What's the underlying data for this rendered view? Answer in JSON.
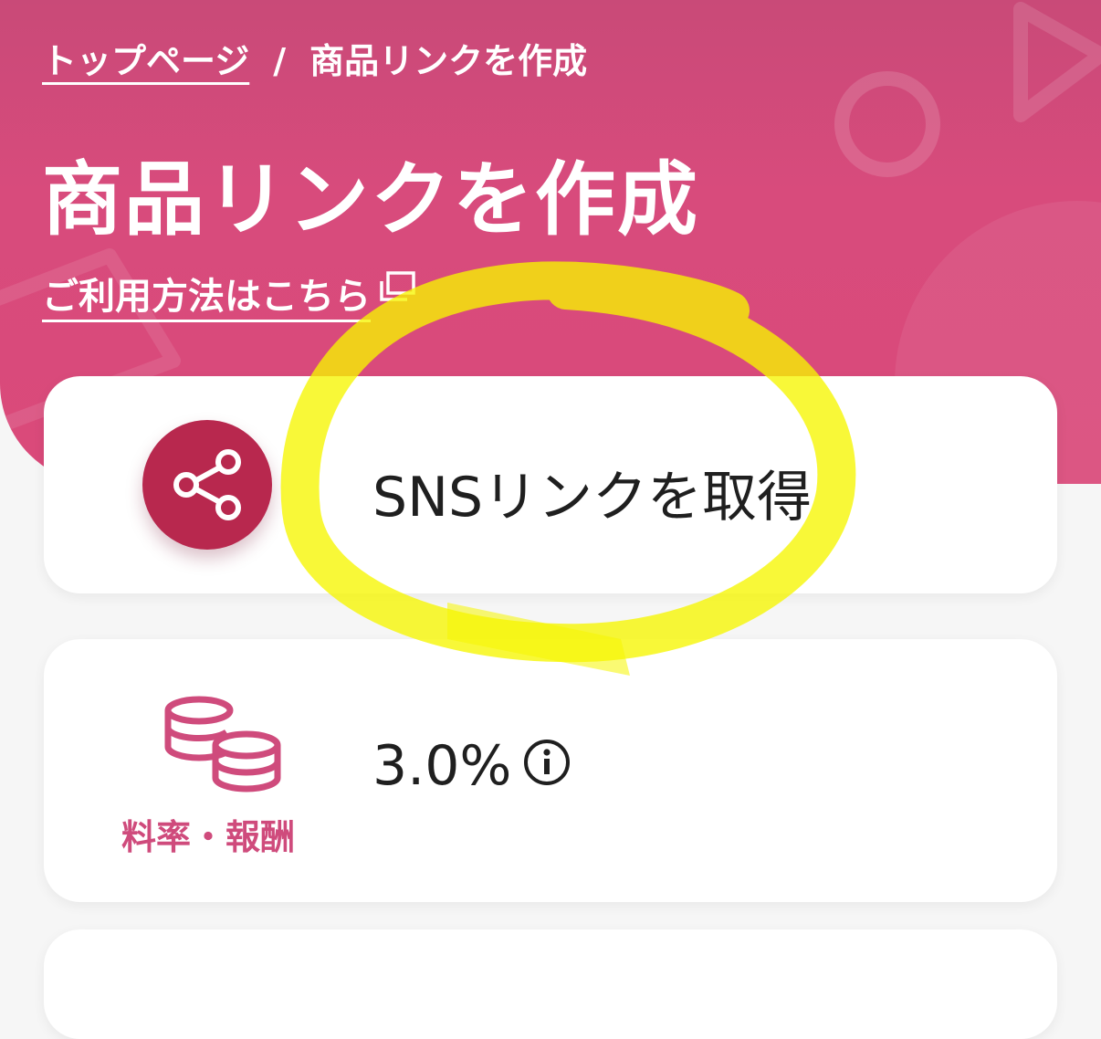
{
  "breadcrumb": {
    "home": "トップページ",
    "separator": "/",
    "current": "商品リンクを作成"
  },
  "page": {
    "title": "商品リンクを作成",
    "help_link": "ご利用方法はこちら"
  },
  "sns_card": {
    "label": "SNSリンクを取得",
    "icon": "share-icon"
  },
  "rate_card": {
    "icon": "coins-icon",
    "caption": "料率・報酬",
    "value": "3.0%",
    "info_icon": "info-icon"
  },
  "colors": {
    "hero": "#d84b7c",
    "share_button": "#b8284e",
    "accent_text": "#cf4b7c",
    "highlight": "#f4f400"
  }
}
